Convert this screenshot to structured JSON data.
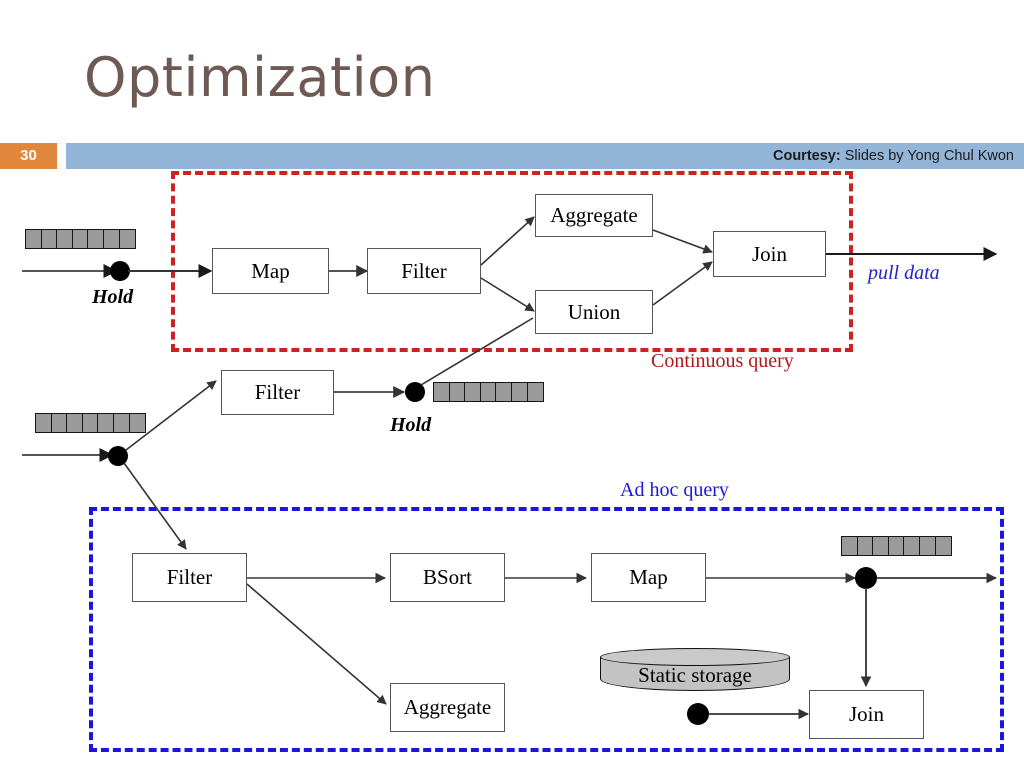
{
  "slide": {
    "title": "Optimization",
    "page_number": "30",
    "courtesy_label": "Courtesy:",
    "courtesy_text": "Slides by Yong Chul Kwon",
    "colors": {
      "title": "#6e5a52",
      "page_number_box": "#e0873c",
      "header_bar": "#92b4d6",
      "continuous_query": "#cc2222",
      "adhoc_query": "#1a16e0",
      "queue_cell": "#9a9a9a",
      "static_storage": "#c3c3c3"
    }
  },
  "regions": {
    "continuous_query": {
      "label": "Continuous query"
    },
    "adhoc_query": {
      "label": "Ad hoc query"
    }
  },
  "annotations": {
    "pull_data": "pull data",
    "hold_top": "Hold",
    "hold_middle": "Hold"
  },
  "continuous_query_pipeline": {
    "operators": [
      {
        "id": "cq-map",
        "label": "Map"
      },
      {
        "id": "cq-filter",
        "label": "Filter"
      },
      {
        "id": "cq-aggregate",
        "label": "Aggregate"
      },
      {
        "id": "cq-union",
        "label": "Union"
      },
      {
        "id": "cq-join",
        "label": "Join"
      }
    ]
  },
  "middle_pipeline": {
    "operators": [
      {
        "id": "mid-filter",
        "label": "Filter"
      }
    ]
  },
  "adhoc_query_pipeline": {
    "operators": [
      {
        "id": "ah-filter",
        "label": "Filter"
      },
      {
        "id": "ah-bsort",
        "label": "BSort"
      },
      {
        "id": "ah-map",
        "label": "Map"
      },
      {
        "id": "ah-aggregate",
        "label": "Aggregate"
      },
      {
        "id": "ah-join",
        "label": "Join"
      }
    ],
    "storage": {
      "id": "static-storage",
      "label": "Static storage"
    }
  },
  "queues": {
    "cell_count": 7,
    "items": [
      {
        "id": "queue-top",
        "cells": 7
      },
      {
        "id": "queue-middle-in",
        "cells": 7
      },
      {
        "id": "queue-middle-hold",
        "cells": 7
      },
      {
        "id": "queue-adhoc",
        "cells": 7
      }
    ]
  }
}
